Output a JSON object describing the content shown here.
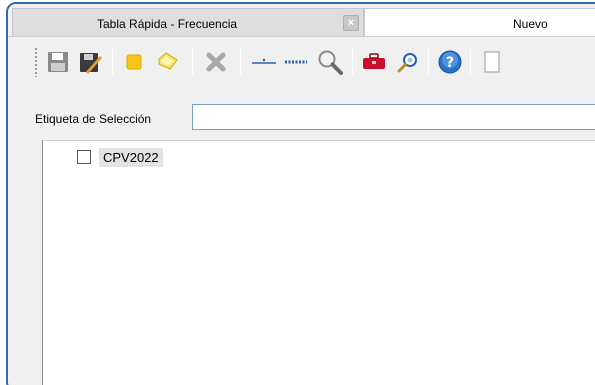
{
  "tabs": [
    {
      "label": "Tabla Rápida - Frecuencia",
      "active": false,
      "close_icon": "close-icon"
    },
    {
      "label": "Nuevo",
      "active": true
    }
  ],
  "toolbar": {
    "buttons": [
      {
        "name": "save-button",
        "icon": "floppy-disk-icon"
      },
      {
        "name": "save-as-button",
        "icon": "floppy-pencil-icon"
      },
      {
        "name": "new-set-button",
        "icon": "yellow-square-icon"
      },
      {
        "name": "open-set-button",
        "icon": "yellow-folder-icon"
      },
      {
        "name": "delete-button",
        "icon": "gray-x-icon"
      },
      {
        "name": "single-line-button",
        "icon": "line-dot-icon"
      },
      {
        "name": "dotted-line-button",
        "icon": "dotted-line-icon"
      },
      {
        "name": "search-button",
        "icon": "magnifier-icon"
      },
      {
        "name": "toolbox-button",
        "icon": "red-toolbox-icon"
      },
      {
        "name": "find-button",
        "icon": "small-magnifier-icon"
      },
      {
        "name": "help-button",
        "icon": "help-icon"
      }
    ]
  },
  "selection": {
    "label": "Etiqueta de Selección",
    "value": ""
  },
  "tree": {
    "items": [
      {
        "label": "CPV2022",
        "checked": false
      }
    ]
  },
  "colors": {
    "frame_border": "#2f6db3",
    "input_border": "#7a9cc6",
    "help_blue": "#2a72c8",
    "toolbox_red": "#c8102e"
  }
}
